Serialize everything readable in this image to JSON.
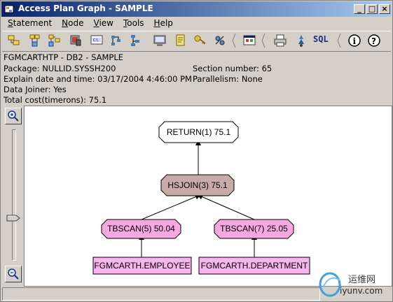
{
  "window": {
    "title": "Access Plan Graph - SAMPLE",
    "buttons": [
      "_",
      "□",
      "×"
    ]
  },
  "menu": {
    "items": [
      {
        "label": "Statement",
        "mnemonic": "S"
      },
      {
        "label": "Node",
        "mnemonic": "N"
      },
      {
        "label": "View",
        "mnemonic": "V"
      },
      {
        "label": "Tools",
        "mnemonic": "T"
      },
      {
        "label": "Help",
        "mnemonic": "H"
      }
    ]
  },
  "toolbar": {
    "sql_label": "SQL"
  },
  "info": {
    "header": "FGMCARTHTP - DB2 - SAMPLE",
    "package": "Package: NULLID.SYSSH200",
    "explain": "Explain date and time: 03/17/2004 4:46:00 PM",
    "data_joiner": "Data Joiner: Yes",
    "total_cost": "Total cost(timerons): 75.1",
    "section": "Section number: 65",
    "parallelism": "Parallelism: None"
  },
  "graph": {
    "return_node": "RETURN(1) 75.1",
    "hsjoin_node": "HSJOIN(3) 75.1",
    "tbscan5_node": "TBSCAN(5) 50.04",
    "tbscan7_node": "TBSCAN(7) 25.05",
    "table_employee": "FGMCARTH.EMPLOYEE",
    "table_department": "FGMCARTH.DEPARTMENT"
  },
  "colors": {
    "return_fill": "#ffffff",
    "hsjoin_fill": "#c9aaa8",
    "tbscan_fill": "#f7a8e0",
    "table_fill": "#f6b5ec"
  },
  "icons": [
    "open-icon",
    "statement-history-icon",
    "node-icon",
    "db-icon",
    "sql-statement-icon",
    "graph-icon",
    "settings-icon",
    "monitor-icon",
    "notepad-icon",
    "key-icon",
    "tool-icon",
    "properties-icon",
    "print-icon",
    "explain-icon",
    "sql-icon",
    "info-icon",
    "help-icon",
    "zoom-in-icon",
    "zoom-out-icon"
  ],
  "watermark": {
    "cn": "运维网",
    "url": "iyunv.com"
  }
}
